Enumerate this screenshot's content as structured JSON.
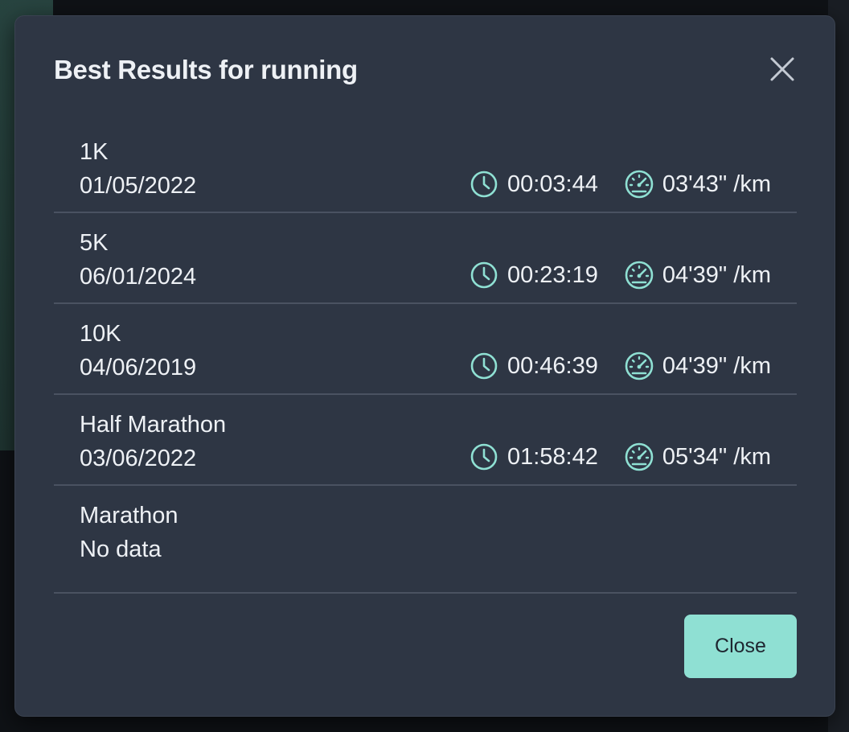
{
  "modal": {
    "title": "Best Results for running",
    "close_button_label": "Close",
    "accent_color": "#8fe0d3",
    "icons": {
      "close": "close-icon",
      "time": "clock-icon",
      "pace": "speedometer-icon"
    }
  },
  "results": [
    {
      "name": "1K",
      "date": "01/05/2022",
      "time": "00:03:44",
      "pace": "03'43\" /km"
    },
    {
      "name": "5K",
      "date": "06/01/2024",
      "time": "00:23:19",
      "pace": "04'39\" /km"
    },
    {
      "name": "10K",
      "date": "04/06/2019",
      "time": "00:46:39",
      "pace": "04'39\" /km"
    },
    {
      "name": "Half Marathon",
      "date": "03/06/2022",
      "time": "01:58:42",
      "pace": "05'34\" /km"
    },
    {
      "name": "Marathon",
      "date": "No data"
    }
  ]
}
